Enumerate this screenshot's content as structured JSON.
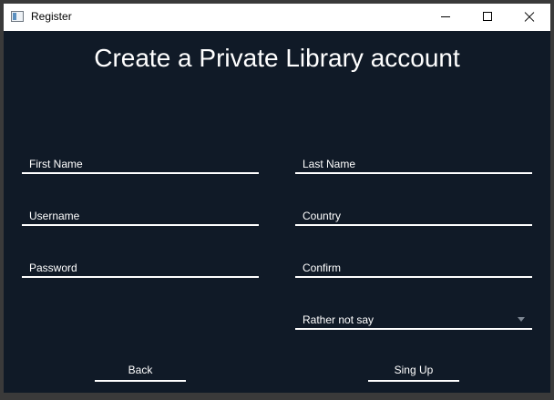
{
  "window": {
    "title": "Register"
  },
  "heading": "Create a Private Library account",
  "form": {
    "first_name": {
      "placeholder": "First Name"
    },
    "last_name": {
      "placeholder": "Last Name"
    },
    "username": {
      "placeholder": "Username"
    },
    "country": {
      "placeholder": "Country"
    },
    "password": {
      "placeholder": "Password"
    },
    "confirm": {
      "placeholder": "Confirm"
    },
    "gender_select": {
      "selected": "Rather not say"
    }
  },
  "buttons": {
    "back": "Back",
    "signup": "Sing Up"
  },
  "icons": {
    "app": "window-app-icon",
    "minimize": "minimize-icon",
    "maximize": "maximize-icon",
    "close": "close-icon",
    "dropdown": "chevron-down-icon"
  },
  "colors": {
    "background": "#101a27",
    "text": "#ffffff",
    "underline": "#ffffff"
  }
}
